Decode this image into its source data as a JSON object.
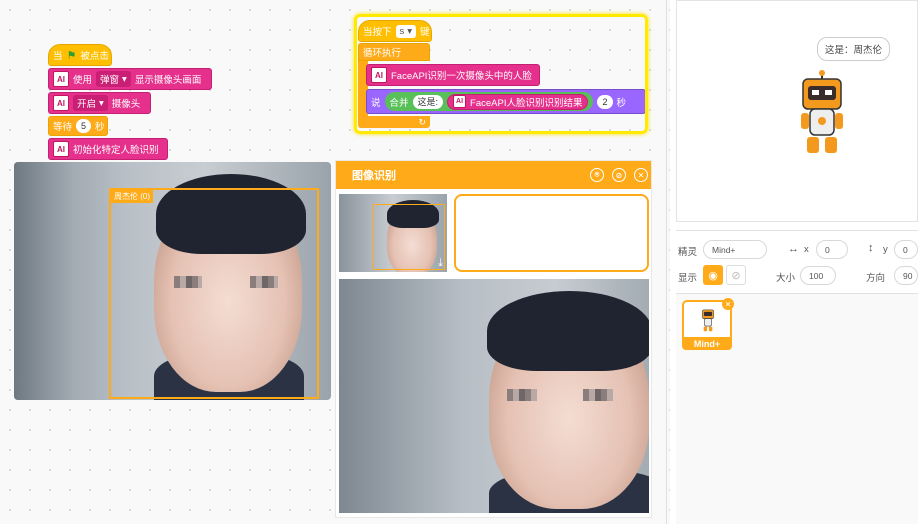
{
  "blocks": {
    "when_flag": "当",
    "when_flag2": "被点击",
    "use": "使用",
    "popup": "弹窗",
    "show_cam": "显示摄像头画面",
    "open": "开启",
    "camera": "摄像头",
    "wait": "等待",
    "wait_val": "5",
    "sec": "秒",
    "init_face": "初始化特定人脸识别",
    "when_key": "当按下",
    "key": "s",
    "key2": "键",
    "forever": "循环执行",
    "faceapi_detect": "FaceAPI识别一次摄像头中的人脸",
    "say": "说",
    "join": "合并",
    "this_is": "这是:",
    "faceapi_result": "FaceAPI人脸识别识别结果",
    "say_secs": "2",
    "sec2": "秒"
  },
  "camera": {
    "face_label": "周杰伦 (0)"
  },
  "panel": {
    "title": "图像识别"
  },
  "stage": {
    "bubble": "这是：周杰伦"
  },
  "sprite_info": {
    "sprite_label": "精灵",
    "sprite_name": "Mind+",
    "x_label": "x",
    "x_val": "0",
    "y_label": "y",
    "y_val": "0",
    "show_label": "显示",
    "size_label": "大小",
    "size_val": "100",
    "dir_label": "方向",
    "dir_val": "90"
  },
  "sprite_list": {
    "name": "Mind+"
  },
  "colors": {
    "event": "#ffbf00",
    "ai": "#e6318c",
    "control": "#ffab19",
    "operator": "#59c059"
  }
}
